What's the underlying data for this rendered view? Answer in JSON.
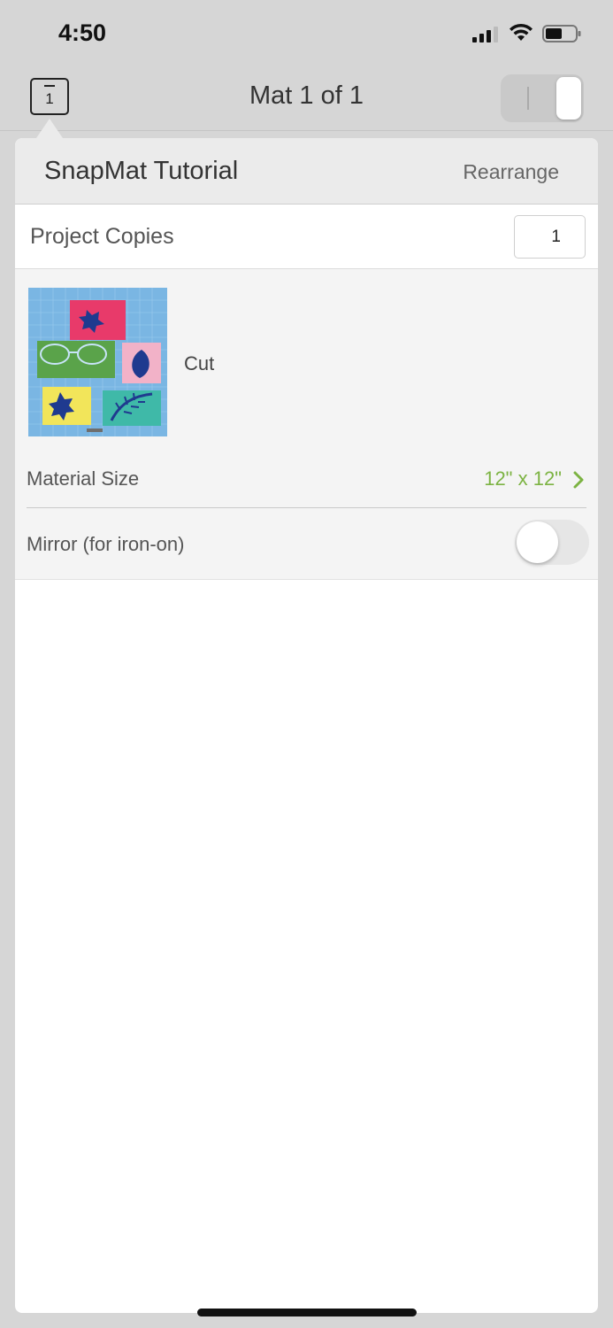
{
  "status_bar": {
    "time": "4:50"
  },
  "nav": {
    "mat_icon_number": "1",
    "title": "Mat 1 of 1"
  },
  "popover": {
    "title": "SnapMat Tutorial",
    "rearrange_label": "Rearrange",
    "project_copies_label": "Project Copies",
    "project_copies_value": "1",
    "mat": {
      "operation_label": "Cut",
      "material_size_label": "Material Size",
      "material_size_value": "12\" x 12\"",
      "mirror_label": "Mirror (for iron-on)",
      "mirror_on": false
    }
  },
  "colors": {
    "accent_green": "#7cb342",
    "mat_blue": "#7ab6e3",
    "pink": "#e83a6a",
    "green": "#5aa34a",
    "light_pink": "#f2b2c8",
    "yellow": "#f2e55a",
    "teal": "#3fb9a8",
    "design_navy": "#1f3a8f"
  }
}
